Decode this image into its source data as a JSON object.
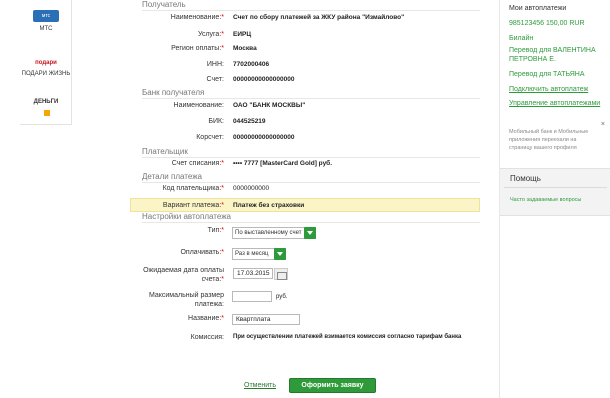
{
  "left_providers": {
    "mts": {
      "label": "МТС",
      "logo_text": "мтс"
    },
    "podari": {
      "label": "ПОДАРИ ЖИЗНЬ",
      "logo_text": "подари"
    },
    "yandex": {
      "logo_text": "ДЕНЬГИ"
    }
  },
  "sections": {
    "recipient": "Получатель",
    "bank": "Банк получателя",
    "payer": "Плательщик",
    "details": "Детали платежа",
    "autopay": "Настройки автоплатежа"
  },
  "recipient": {
    "name_label": "Наименование",
    "name_value": "Счет по сбору платежей за ЖКУ района \"Измайлово\"",
    "service_label": "Услуга",
    "service_value": "ЕИРЦ",
    "region_label": "Регион оплаты",
    "region_value": "Москва",
    "inn_label": "ИНН",
    "inn_value": "7702000406",
    "account_label": "Счет",
    "account_value": "00000000000000000"
  },
  "bank": {
    "name_label": "Наименование",
    "name_value": "ОАО \"БАНК МОСКВЫ\"",
    "bik_label": "БИК",
    "bik_value": "044525219",
    "corr_label": "Корсчет",
    "corr_value": "00000000000000000"
  },
  "payer": {
    "account_label": "Счет списания",
    "account_value": "•••• 7777 [MasterCard Gold] руб."
  },
  "details": {
    "payer_code_label": "Код плательщика",
    "payer_code_value": "0000000000",
    "variant_label": "Вариант платежа",
    "variant_value": "Платеж без страховки"
  },
  "autopay": {
    "type_label": "Тип",
    "type_value": "По выставленному счет",
    "pay_label": "Оплачивать",
    "pay_value": "Раз в месяц",
    "date_label_1": "Ожидаемая дата оплаты",
    "date_label_2": "счета",
    "date_value": "17.03.2015",
    "max_label_1": "Максимальный размер",
    "max_label_2": "платежа",
    "max_value": "",
    "max_unit": "руб.",
    "name_label": "Название",
    "name_value": "Квартплата",
    "fee_label": "Комиссия",
    "fee_value": "При осуществлении платежей взимается комиссия согласно тарифам банка"
  },
  "actions": {
    "cancel": "Отменить",
    "submit": "Оформить заявку"
  },
  "sidebar": {
    "title": "Мои автоплатежи",
    "phone_payment": "985123456 150,00 RUR",
    "beeline": "Билайн",
    "transfer_1": "Перевод для ВАЛЕНТИНА ПЕТРОВНА Е.",
    "transfer_2": "Перевод для ТАТЬЯНА",
    "connect": "Подключить автоплатеж",
    "manage": "Управление автоплатежами",
    "info": "Мобильный банк и Мобильные приложения переехали на страницу вашего профиля",
    "close_glyph": "×",
    "help_title": "Помощь",
    "faq": "Часто задаваемые вопросы"
  },
  "colors": {
    "accent_green": "#2e9a3c",
    "required_red": "#cc0000",
    "highlight": "#fbf4c7"
  }
}
